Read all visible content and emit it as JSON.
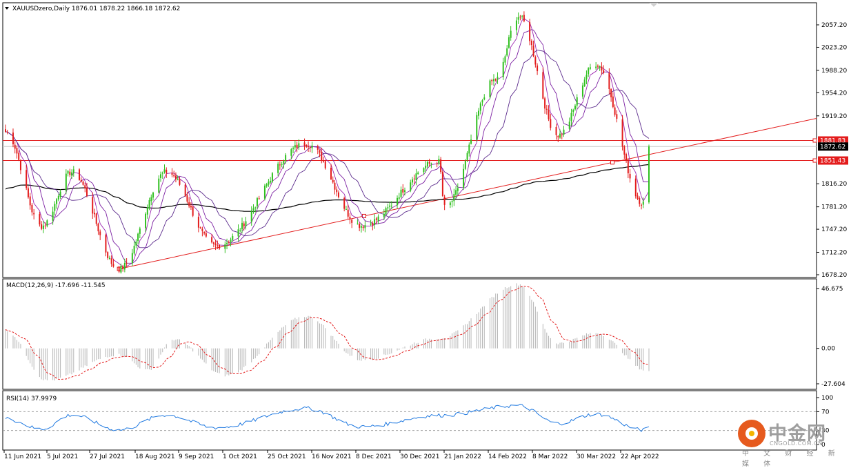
{
  "chart_data": [
    {
      "type": "candlestick",
      "symbol": "XAUUSDzero",
      "timeframe": "Daily",
      "header_text": "XAUUSDzero,Daily  1876.01 1878.22 1866.18 1872.62",
      "last_ohlc": {
        "open": 1876.01,
        "high": 1878.22,
        "low": 1866.18,
        "close": 1872.62
      },
      "y_ticks": [
        "2057.20",
        "2023.20",
        "1988.20",
        "1954.20",
        "1919.20",
        "1816.20",
        "1781.20",
        "1747.20",
        "1712.20",
        "1678.20"
      ],
      "ylim": [
        1678.2,
        2057.2
      ],
      "price_tags": [
        {
          "value": "1881.83",
          "color": "#e31c1c"
        },
        {
          "value": "1872.62",
          "color": "#000000"
        },
        {
          "value": "1851.43",
          "color": "#e31c1c"
        }
      ],
      "horizontal_lines": [
        1881.83,
        1851.43
      ],
      "x_labels": [
        "11 Jun 2021",
        "5 Jul 2021",
        "27 Jul 2021",
        "18 Aug 2021",
        "9 Sep 2021",
        "1 Oct 2021",
        "25 Oct 2021",
        "16 Nov 2021",
        "8 Dec 2021",
        "30 Dec 2021",
        "21 Jan 2022",
        "14 Feb 2022",
        "8 Mar 2022",
        "30 Mar 2022",
        "22 Apr 2022"
      ],
      "trendline": {
        "from": {
          "date": "2021-08-09",
          "price": 1687
        },
        "to": {
          "date": "2022-06-10",
          "price": 1876
        }
      },
      "key_prices": [
        {
          "date": "2021-06-10",
          "price": 1895
        },
        {
          "date": "2021-06-29",
          "price": 1752
        },
        {
          "date": "2021-07-15",
          "price": 1834
        },
        {
          "date": "2021-08-09",
          "price": 1687
        },
        {
          "date": "2021-09-03",
          "price": 1834
        },
        {
          "date": "2021-09-29",
          "price": 1722
        },
        {
          "date": "2021-11-16",
          "price": 1877
        },
        {
          "date": "2021-12-15",
          "price": 1753
        },
        {
          "date": "2022-01-25",
          "price": 1850
        },
        {
          "date": "2022-01-28",
          "price": 1780
        },
        {
          "date": "2022-02-24",
          "price": 1974
        },
        {
          "date": "2022-03-08",
          "price": 2070
        },
        {
          "date": "2022-03-29",
          "price": 1890
        },
        {
          "date": "2022-04-18",
          "price": 1998
        },
        {
          "date": "2022-05-13",
          "price": 1787
        },
        {
          "date": "2022-05-16",
          "price": 1872.62
        }
      ],
      "colors": {
        "bull": "#2fbf1f",
        "bear": "#e31c1c",
        "ma200": "#000000",
        "ma_fast": "#9c27b0",
        "grid_line": "#e31c1c"
      }
    },
    {
      "type": "histogram+line",
      "label": "MACD(12,26,9) -17.696 -11.545",
      "y_ticks": [
        "46.675",
        "0.00",
        "-27.604"
      ],
      "ylim": [
        -27.604,
        46.675
      ],
      "macd_last": -17.696,
      "signal_last": -11.545,
      "key_values": [
        {
          "date": "2021-06-10",
          "value": 14
        },
        {
          "date": "2021-07-02",
          "value": -25
        },
        {
          "date": "2021-08-09",
          "value": -5
        },
        {
          "date": "2021-08-24",
          "value": -17
        },
        {
          "date": "2021-09-07",
          "value": 7
        },
        {
          "date": "2021-10-04",
          "value": -21
        },
        {
          "date": "2021-11-16",
          "value": 25
        },
        {
          "date": "2021-12-15",
          "value": -9
        },
        {
          "date": "2022-01-25",
          "value": 8
        },
        {
          "date": "2022-03-08",
          "value": 50
        },
        {
          "date": "2022-03-29",
          "value": 4
        },
        {
          "date": "2022-04-18",
          "value": 12
        },
        {
          "date": "2022-05-16",
          "value": -17.696
        }
      ],
      "colors": {
        "histogram": "#b4b4b4",
        "signal": "#e31c1c"
      }
    },
    {
      "type": "line",
      "label": "RSI(14) 37.9979",
      "y_ticks": [
        "100",
        "70",
        "30",
        "0"
      ],
      "ylim": [
        0,
        100
      ],
      "last_value": 37.9979,
      "key_values": [
        {
          "date": "2021-06-10",
          "value": 55
        },
        {
          "date": "2021-06-29",
          "value": 33
        },
        {
          "date": "2021-07-15",
          "value": 63
        },
        {
          "date": "2021-08-09",
          "value": 31
        },
        {
          "date": "2021-09-03",
          "value": 63
        },
        {
          "date": "2021-09-29",
          "value": 36
        },
        {
          "date": "2021-11-16",
          "value": 77
        },
        {
          "date": "2021-12-15",
          "value": 38
        },
        {
          "date": "2022-01-25",
          "value": 62
        },
        {
          "date": "2022-03-08",
          "value": 83
        },
        {
          "date": "2022-03-29",
          "value": 45
        },
        {
          "date": "2022-04-18",
          "value": 65
        },
        {
          "date": "2022-05-13",
          "value": 31
        },
        {
          "date": "2022-05-16",
          "value": 38
        }
      ],
      "colors": {
        "line": "#1e78e0",
        "levels": "#a0a0a0"
      }
    }
  ],
  "watermark": {
    "title": "中金网",
    "site": "CNGOLD.COM.CN",
    "tagline": "中 文 财 经 新 媒 体"
  }
}
